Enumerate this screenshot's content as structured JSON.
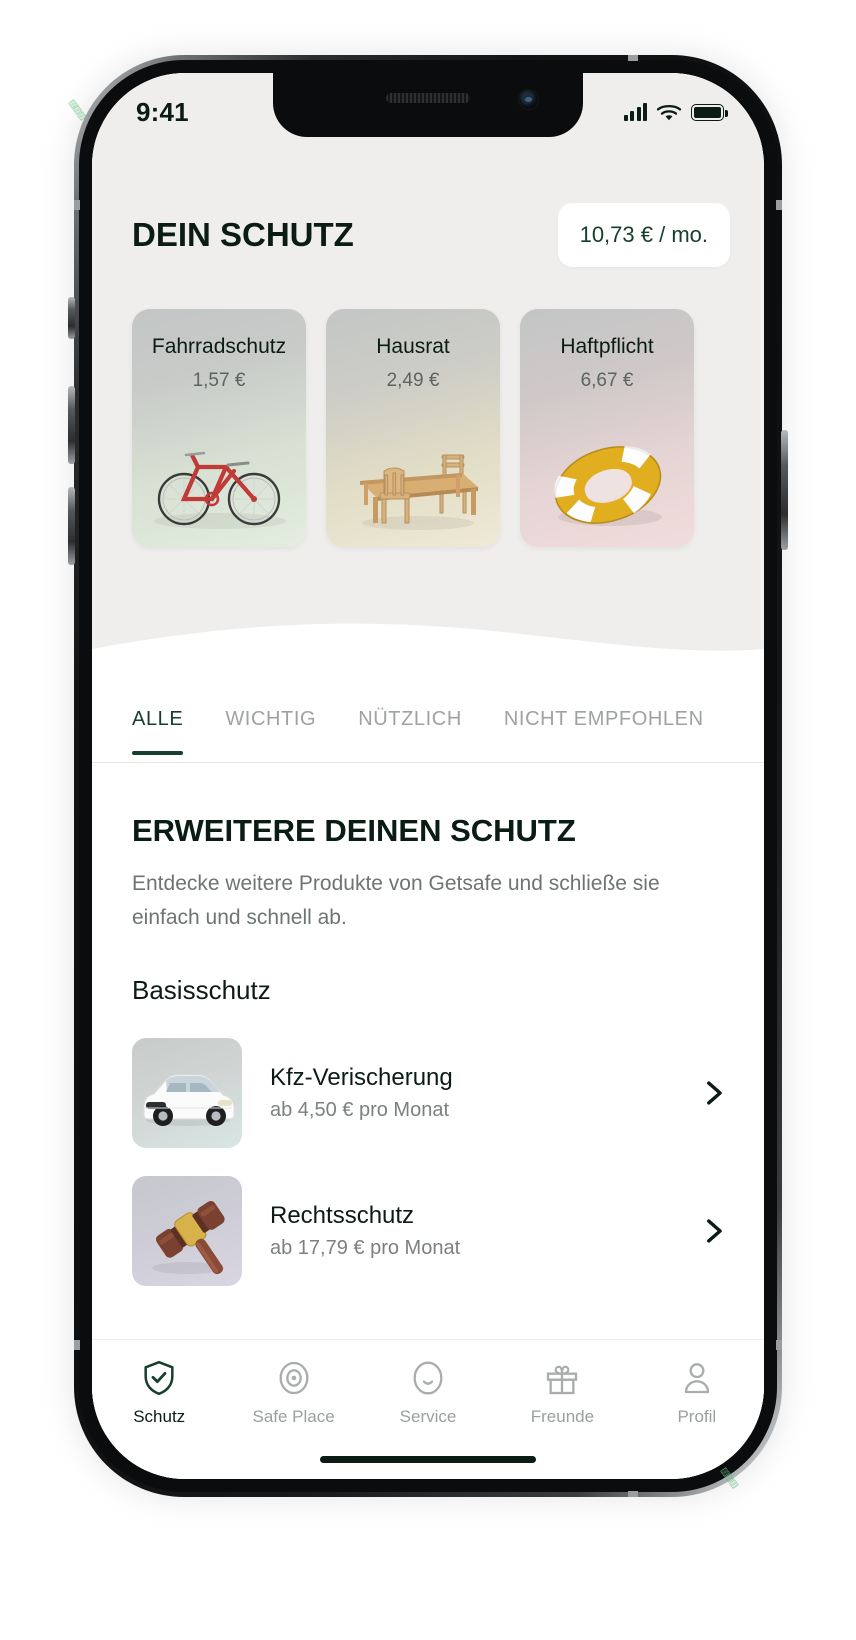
{
  "status_bar": {
    "time": "9:41",
    "signal_icon": "cellular-bars-icon",
    "wifi_icon": "wifi-icon",
    "battery_icon": "battery-full-icon"
  },
  "header": {
    "title": "DEIN SCHUTZ",
    "total_price": "10,73 € / mo."
  },
  "colors": {
    "accent_green": "#14402c",
    "ink": "#0b1c14",
    "muted": "#6d7573",
    "hero_bg": "#efeeec"
  },
  "policy_cards": [
    {
      "name": "Fahrradschutz",
      "price": "1,57 €",
      "art": "bicycle-illustration"
    },
    {
      "name": "Hausrat",
      "price": "2,49 €",
      "art": "dining-table-illustration"
    },
    {
      "name": "Haftpflicht",
      "price": "6,67 €",
      "art": "life-ring-illustration"
    }
  ],
  "tabs": [
    {
      "label": "ALLE",
      "active": true
    },
    {
      "label": "WICHTIG",
      "active": false
    },
    {
      "label": "NÜTZLICH",
      "active": false
    },
    {
      "label": "NICHT EMPFOHLEN",
      "active": false
    }
  ],
  "main": {
    "heading": "ERWEITERE DEINEN SCHUTZ",
    "description": "Entdecke weitere Produkte von Getsafe und schließe sie einfach und schnell ab.",
    "group_title": "Basisschutz",
    "products": [
      {
        "title": "Kfz-Verischerung",
        "subtitle": "ab 4,50 € pro Monat",
        "art": "white-car-illustration",
        "chevron": "chevron-right-icon"
      },
      {
        "title": "Rechtsschutz",
        "subtitle": "ab 17,79 € pro Monat",
        "art": "gavel-illustration",
        "chevron": "chevron-right-icon"
      }
    ]
  },
  "bottom_nav": [
    {
      "label": "Schutz",
      "icon": "shield-check-icon",
      "active": true
    },
    {
      "label": "Safe Place",
      "icon": "target-circle-icon",
      "active": false
    },
    {
      "label": "Service",
      "icon": "smiley-face-icon",
      "active": false
    },
    {
      "label": "Freunde",
      "icon": "gift-icon",
      "active": false
    },
    {
      "label": "Profil",
      "icon": "person-icon",
      "active": false
    }
  ]
}
